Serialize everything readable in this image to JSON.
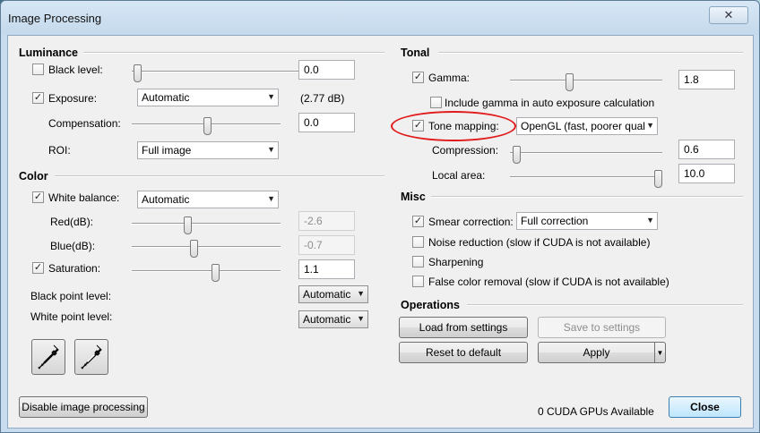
{
  "window": {
    "title": "Image Processing",
    "close_glyph": "✕"
  },
  "luminance": {
    "title": "Luminance",
    "black_level": {
      "label": "Black level:",
      "checked": false,
      "value": "0.0"
    },
    "exposure": {
      "label": "Exposure:",
      "checked": true,
      "mode": "Automatic",
      "db_readout": "(2.77 dB)"
    },
    "compensation": {
      "label": "Compensation:",
      "value": "0.0"
    },
    "roi": {
      "label": "ROI:",
      "value": "Full image"
    }
  },
  "color": {
    "title": "Color",
    "white_balance": {
      "label": "White balance:",
      "checked": true,
      "mode": "Automatic"
    },
    "red": {
      "label": "Red(dB):",
      "value": "-2.6"
    },
    "blue": {
      "label": "Blue(dB):",
      "value": "-0.7"
    },
    "saturation": {
      "label": "Saturation:",
      "checked": true,
      "value": "1.1"
    },
    "black_point": {
      "label": "Black point level:",
      "value": "Automatic"
    },
    "white_point": {
      "label": "White point level:",
      "value": "Automatic"
    }
  },
  "tonal": {
    "title": "Tonal",
    "gamma": {
      "label": "Gamma:",
      "checked": true,
      "value": "1.8"
    },
    "include_gamma": {
      "label": "Include gamma in auto exposure calculation",
      "checked": false
    },
    "tone_mapping": {
      "label": "Tone mapping:",
      "checked": true,
      "mode": "OpenGL (fast, poorer qual"
    },
    "compression": {
      "label": "Compression:",
      "value": "0.6"
    },
    "local_area": {
      "label": "Local area:",
      "value": "10.0"
    }
  },
  "misc": {
    "title": "Misc",
    "smear": {
      "label": "Smear correction:",
      "checked": true,
      "mode": "Full correction"
    },
    "noise": {
      "label": "Noise reduction (slow if CUDA is not available)",
      "checked": false
    },
    "sharpening": {
      "label": "Sharpening",
      "checked": false
    },
    "false_color": {
      "label": "False color removal (slow if CUDA is not available)",
      "checked": false
    }
  },
  "operations": {
    "title": "Operations",
    "load": "Load from settings",
    "save": "Save to settings",
    "reset": "Reset to default",
    "apply": "Apply"
  },
  "footer": {
    "disable": "Disable image processing",
    "cuda_status": "0 CUDA GPUs Available",
    "close": "Close"
  },
  "icons": {
    "checkmark": "✓",
    "dropdown": "▼",
    "accent_highlight": "#e11b1b"
  }
}
